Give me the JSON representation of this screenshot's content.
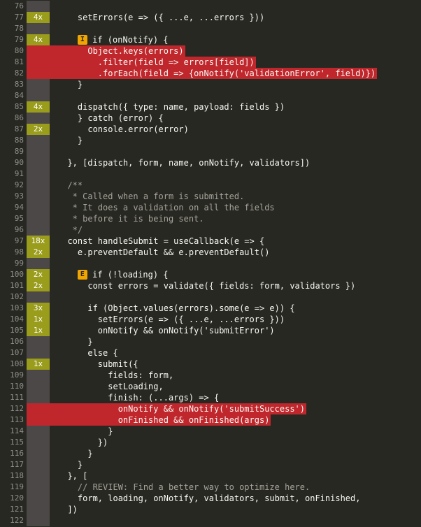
{
  "lines": [
    {
      "n": "76",
      "cov": "",
      "text": ""
    },
    {
      "n": "77",
      "cov": "4x",
      "text": "    setErrors(e => ({ ...e, ...errors }))"
    },
    {
      "n": "78",
      "cov": "",
      "text": ""
    },
    {
      "n": "79",
      "cov": "4x",
      "text": "    if (onNotify) {",
      "badge": "I"
    },
    {
      "n": "80",
      "cov": "",
      "text": "      Object.keys(errors)",
      "hl": true
    },
    {
      "n": "81",
      "cov": "",
      "text": "        .filter(field => errors[field])",
      "hl": true
    },
    {
      "n": "82",
      "cov": "",
      "text": "        .forEach(field => {onNotify('validationError', field)})",
      "hl": true
    },
    {
      "n": "83",
      "cov": "",
      "text": "    }"
    },
    {
      "n": "84",
      "cov": "",
      "text": ""
    },
    {
      "n": "85",
      "cov": "4x",
      "text": "    dispatch({ type: name, payload: fields })"
    },
    {
      "n": "86",
      "cov": "",
      "text": "    } catch (error) {"
    },
    {
      "n": "87",
      "cov": "2x",
      "text": "      console.error(error)"
    },
    {
      "n": "88",
      "cov": "",
      "text": "    }"
    },
    {
      "n": "89",
      "cov": "",
      "text": ""
    },
    {
      "n": "90",
      "cov": "",
      "text": "  }, [dispatch, form, name, onNotify, validators])"
    },
    {
      "n": "91",
      "cov": "",
      "text": ""
    },
    {
      "n": "92",
      "cov": "",
      "text": "  /**"
    },
    {
      "n": "93",
      "cov": "",
      "text": "   * Called when a form is submitted."
    },
    {
      "n": "94",
      "cov": "",
      "text": "   * It does a validation on all the fields"
    },
    {
      "n": "95",
      "cov": "",
      "text": "   * before it is being sent."
    },
    {
      "n": "96",
      "cov": "",
      "text": "   */"
    },
    {
      "n": "97",
      "cov": "18x",
      "text": "  const handleSubmit = useCallback(e => {"
    },
    {
      "n": "98",
      "cov": "2x",
      "text": "    e.preventDefault && e.preventDefault()"
    },
    {
      "n": "99",
      "cov": "",
      "text": ""
    },
    {
      "n": "100",
      "cov": "2x",
      "text": "    if (!loading) {",
      "badge": "E"
    },
    {
      "n": "101",
      "cov": "2x",
      "text": "      const errors = validate({ fields: form, validators })"
    },
    {
      "n": "102",
      "cov": "",
      "text": ""
    },
    {
      "n": "103",
      "cov": "3x",
      "text": "      if (Object.values(errors).some(e => e)) {"
    },
    {
      "n": "104",
      "cov": "1x",
      "text": "        setErrors(e => ({ ...e, ...errors }))"
    },
    {
      "n": "105",
      "cov": "1x",
      "text": "        onNotify && onNotify('submitError')"
    },
    {
      "n": "106",
      "cov": "",
      "text": "      }"
    },
    {
      "n": "107",
      "cov": "",
      "text": "      else {"
    },
    {
      "n": "108",
      "cov": "1x",
      "text": "        submit({"
    },
    {
      "n": "109",
      "cov": "",
      "text": "          fields: form,"
    },
    {
      "n": "110",
      "cov": "",
      "text": "          setLoading,"
    },
    {
      "n": "111",
      "cov": "",
      "text": "          finish: (...args) => {"
    },
    {
      "n": "112",
      "cov": "",
      "text": "            onNotify && onNotify('submitSuccess')",
      "hl": true
    },
    {
      "n": "113",
      "cov": "",
      "text": "            onFinished && onFinished(args)",
      "hl": true
    },
    {
      "n": "114",
      "cov": "",
      "text": "          }"
    },
    {
      "n": "115",
      "cov": "",
      "text": "        })"
    },
    {
      "n": "116",
      "cov": "",
      "text": "      }"
    },
    {
      "n": "117",
      "cov": "",
      "text": "    }"
    },
    {
      "n": "118",
      "cov": "",
      "text": "  }, ["
    },
    {
      "n": "119",
      "cov": "",
      "text": "    // REVIEW: Find a better way to optimize here."
    },
    {
      "n": "120",
      "cov": "",
      "text": "    form, loading, onNotify, validators, submit, onFinished,"
    },
    {
      "n": "121",
      "cov": "",
      "text": "  ])"
    },
    {
      "n": "122",
      "cov": "",
      "text": ""
    }
  ],
  "colors": {
    "background": "#272822",
    "covered": "#9a9c1c",
    "uncovered": "#c0272d",
    "neutral": "#4d4848",
    "badge": "#f0a500"
  }
}
